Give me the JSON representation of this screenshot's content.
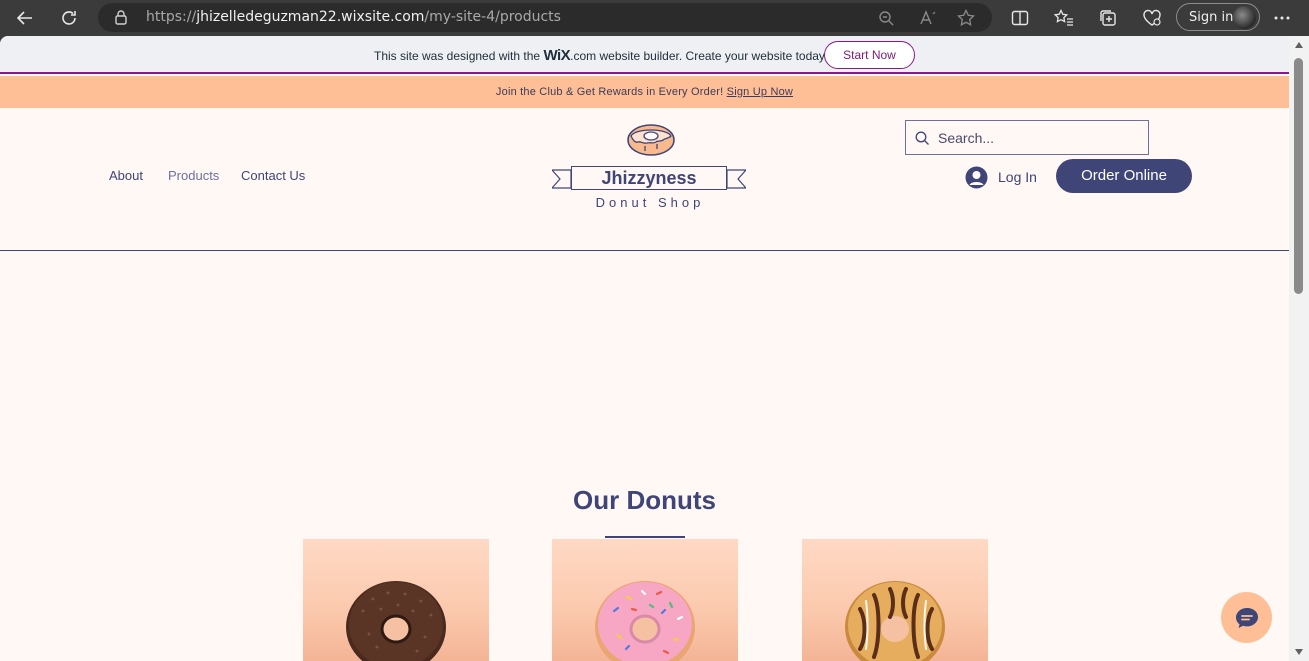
{
  "browser": {
    "url_prefix": "https://",
    "url_host": "jhizelledeguzman22.wixsite.com",
    "url_path": "/my-site-4/products",
    "signin_label": "Sign in"
  },
  "wix_banner": {
    "text_before": "This site was designed with the",
    "brand": "WiX",
    "text_after": ".com website builder. Create your website today.",
    "button_label": "Start Now"
  },
  "promo": {
    "text": "Join the Club & Get Rewards in Every Order!",
    "link": "Sign Up Now"
  },
  "nav": {
    "items": [
      {
        "label": "About"
      },
      {
        "label": "Products"
      },
      {
        "label": "Contact Us"
      }
    ]
  },
  "logo": {
    "name": "Jhizzyness",
    "subtitle": "Donut Shop"
  },
  "header": {
    "search_placeholder": "Search...",
    "login_label": "Log In",
    "order_label": "Order Online"
  },
  "products": {
    "title": "Our Donuts",
    "items": [
      {
        "flavor": "chocolate-sprinkles"
      },
      {
        "flavor": "pink-sprinkles"
      },
      {
        "flavor": "caramel-drizzle"
      }
    ]
  },
  "colors": {
    "brand_navy": "#3f4577",
    "promo_peach": "#ffbf96",
    "page_bg": "#fff8f4",
    "wix_purple": "#8a1a8a"
  }
}
